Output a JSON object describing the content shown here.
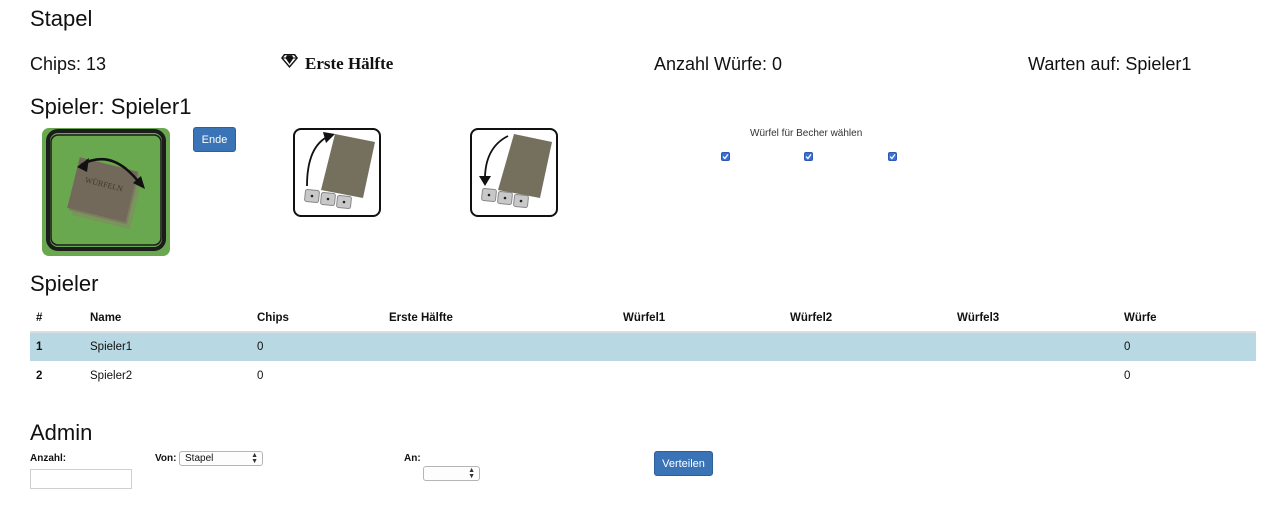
{
  "header": {
    "title": "Stapel",
    "chips": "Chips: 13",
    "half": "Erste Hälfte",
    "throws": "Anzahl Würfe: 0",
    "waiting": "Warten auf: Spieler1"
  },
  "player": {
    "title": "Spieler: Spieler1",
    "end_button": "Ende",
    "cup_text": "WÜRFELN",
    "cup_label": "Würfel für Becher wählen",
    "checkboxes": [
      true,
      true,
      true
    ]
  },
  "players": {
    "title": "Spieler",
    "columns": [
      "#",
      "Name",
      "Chips",
      "Erste Hälfte",
      "Würfel1",
      "Würfel2",
      "Würfel3",
      "Würfe"
    ],
    "rows": [
      [
        "1",
        "Spieler1",
        "0",
        "",
        "",
        "",
        "",
        "0"
      ],
      [
        "2",
        "Spieler2",
        "0",
        "",
        "",
        "",
        "",
        "0"
      ]
    ]
  },
  "admin": {
    "title": "Admin",
    "amount_label": "Anzahl:",
    "from_label": "Von:",
    "from_value": "Stapel",
    "to_label": "An:",
    "to_value": "",
    "distribute_button": "Verteilen"
  },
  "colors": {
    "accent": "#3a74b7",
    "active_row": "#b8d8e4",
    "cup_bg": "#6aa84f"
  }
}
